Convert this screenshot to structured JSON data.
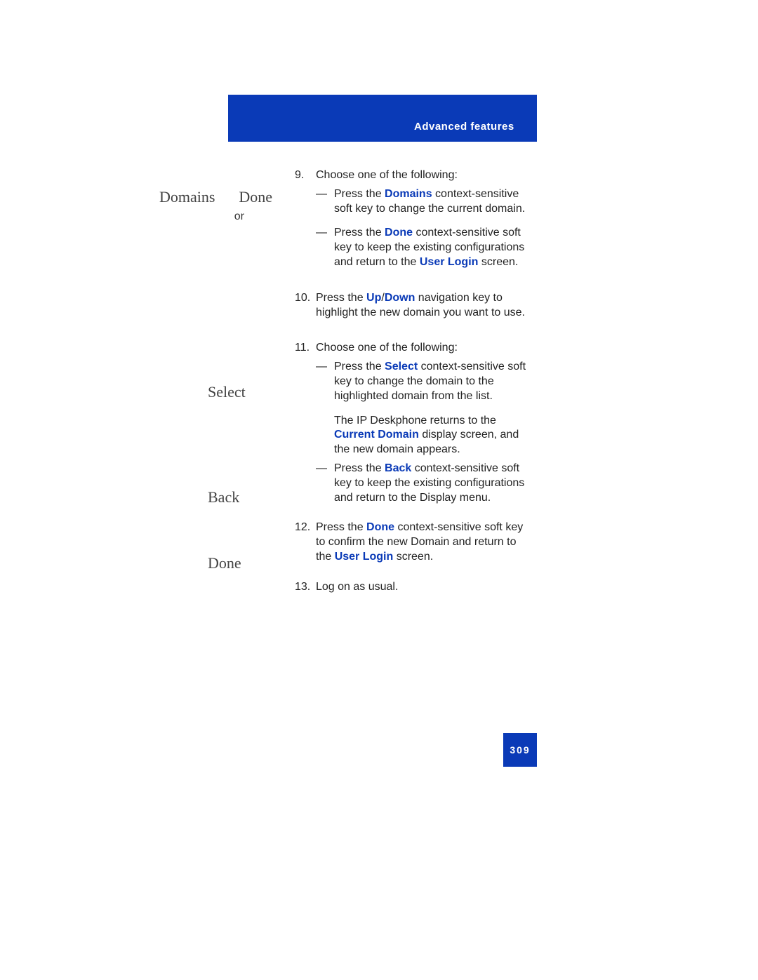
{
  "header": {
    "title": "Advanced features"
  },
  "left": {
    "domains": "Domains",
    "done": "Done",
    "or": "or",
    "select": "Select",
    "back": "Back",
    "done2": "Done"
  },
  "steps": {
    "s9": {
      "num": "9.",
      "lead": "Choose one of the following:",
      "a_pre": "Press the ",
      "a_key": "Domains",
      "a_post": " context-sensitive soft key to change the current domain.",
      "b_pre": "Press the ",
      "b_key": "Done",
      "b_mid": " context-sensitive soft key to keep the existing configurations and return to the ",
      "b_key2": "User Login",
      "b_post": " screen."
    },
    "s10": {
      "num": "10.",
      "pre": "Press the ",
      "key1": "Up",
      "slash": "/",
      "key2": "Down",
      "post": " navigation key to highlight the new domain you want to use."
    },
    "s11": {
      "num": "11.",
      "lead": "Choose one of the following:",
      "a_pre": "Press the ",
      "a_key": "Select",
      "a_post": " context-sensitive soft key to change the domain to the highlighted domain from the list.",
      "mid_pre": "The IP Deskphone returns to the ",
      "mid_key": "Current Domain",
      "mid_post": " display screen, and the new domain appears.",
      "b_pre": "Press the ",
      "b_key": "Back",
      "b_post": " context-sensitive soft key to keep the existing configurations and return to the Display menu."
    },
    "s12": {
      "num": "12.",
      "pre": "Press the ",
      "key": "Done",
      "mid": " context-sensitive soft key to confirm the new Domain and return to the ",
      "key2": "User Login",
      "post": " screen."
    },
    "s13": {
      "num": "13.",
      "text": " Log on as usual."
    }
  },
  "dash": "—",
  "page_number": "309"
}
